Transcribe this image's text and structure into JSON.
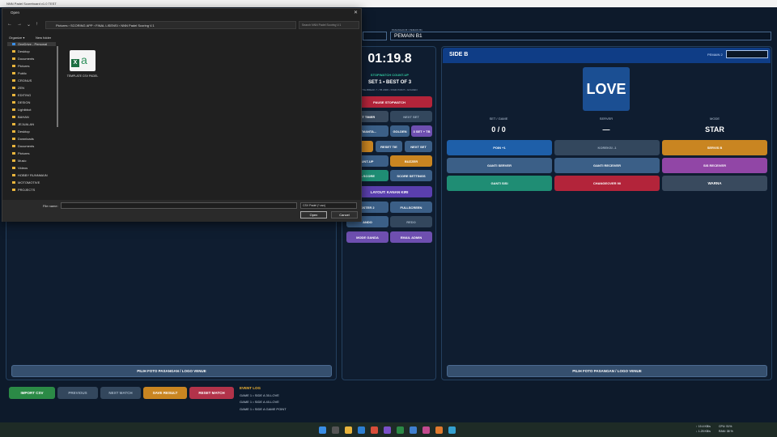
{
  "app": {
    "title": "NNN Padel Scoreboard v1.0 TEST",
    "player_label": "PASANGAN B / PEMAIN B1",
    "player_value": "PEMAIN B1"
  },
  "side_b": {
    "title": "SIDE B",
    "player2_label": "PEMAIN 2",
    "score_display": "LOVE",
    "stats": [
      {
        "label": "SET / GAME",
        "value": "0 / 0"
      },
      {
        "label": "SERVER",
        "value": "—"
      },
      {
        "label": "MODE",
        "value": "STAR"
      }
    ],
    "buttons": [
      "POIN +1",
      "KOREKSI -1",
      "SERVIS B",
      "GANTI SERVER",
      "GANTI RECEIVER",
      "SIS RECEIVER",
      "GANTI SISI",
      "CHANGEOVER 90",
      "WARNA"
    ],
    "photo_button": "PILIH FOTO PASANGAN / LOGO VENUE"
  },
  "side_a": {
    "photo_button": "PILIH FOTO PASANGAN / LOGO VENUE"
  },
  "center": {
    "timer": "01:19.8",
    "stopwatch_label": "STOPWATCH COUNT-UP",
    "set_info": "SET 1 • BEST OF 3",
    "set_sub": "TIE-BREAK 7 • TB 2008 • STAR POINT • GOLDEN",
    "buttons": [
      "PAUSE STOPWATCH",
      "ET TIMER",
      "NEXT SET",
      "ATMANTA...",
      "GOLDEN",
      "3 SET + TB",
      "TB",
      "RESET TIE",
      "NEXT SET",
      "UNT-UP",
      "BUZZER",
      "A SCORE",
      "SCORE SETTINGS",
      "LAYOUT: KANAN  KIRI",
      "OSTER 2",
      "FULLSCREEN",
      "ANDO",
      "REDO",
      "MODE GANDA",
      "EMAIL ADMIN"
    ]
  },
  "bottom": {
    "buttons": [
      "IMPORT CSV",
      "PREVIOUS",
      "NEXT MATCH",
      "SAVE RESULT",
      "RESET MATCH"
    ],
    "event_log_title": "EVENT LOG",
    "event_log": [
      "GAME 1 • SIDE A 30-LOVE",
      "GAME 1 • SIDE A 40-LOVE",
      "GAME 1 • SIDE A GAME POINT"
    ]
  },
  "dialog": {
    "title": "Open",
    "path": "Pictures › SCORING APP › FINAL LISENSI › NNN Padel Scoring V.1",
    "search_placeholder": "Search NNN Padel Scoring V.1",
    "organize": "Organize ▾",
    "new_folder": "New folder",
    "nav_items": [
      "OneDrive - Personal",
      "Desktop",
      "Documents",
      "Pictures",
      "Public",
      "CRONUS",
      "ZEN",
      "EDITING",
      "DESIGN",
      "Lightbbot",
      "BAHAN",
      "JEJUALAN",
      "Desktop",
      "Downloads",
      "Documents",
      "Pictures",
      "Music",
      "Videos",
      "HOBBY RUNNMAIN",
      "MOTOMOTIVE",
      "PROJECTS"
    ],
    "file_name": "TEMPLATE CSV PADEL",
    "file_name_label": "File name:",
    "filter": "CSV Padel (*.csv)",
    "open": "Open",
    "cancel": "Cancel"
  },
  "taskbar": {
    "tray_lines": [
      "↑ 19.4 KB/s",
      "↓ 1.25 KB/s"
    ],
    "tray_lines2": [
      "CPU: 51%",
      "RAM: 38 %"
    ]
  }
}
